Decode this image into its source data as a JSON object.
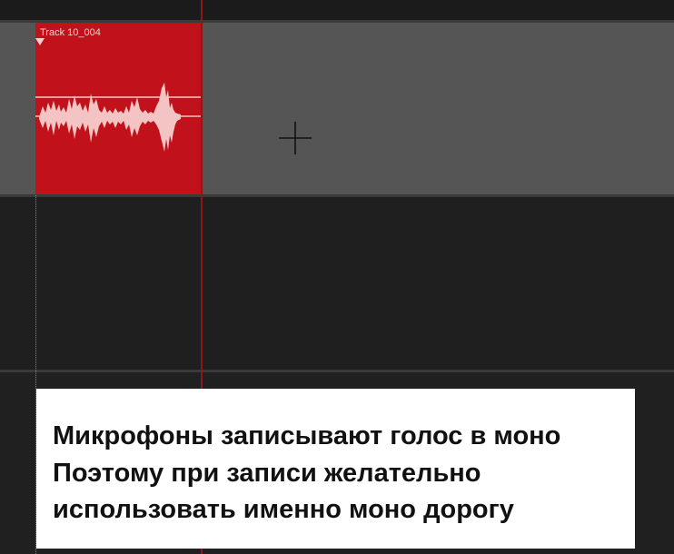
{
  "clip": {
    "name": "Track 10_004",
    "color": "#c1121b",
    "waveform_color": "#f4c4c4"
  },
  "caption": {
    "lines": [
      "Микрофоны записывают голос в моно",
      "Поэтому при записи желательно",
      "использовать именно моно дорогу"
    ]
  },
  "icons": {
    "cursor": "crosshair-cursor-icon",
    "clip_start": "clip-start-marker-icon"
  }
}
